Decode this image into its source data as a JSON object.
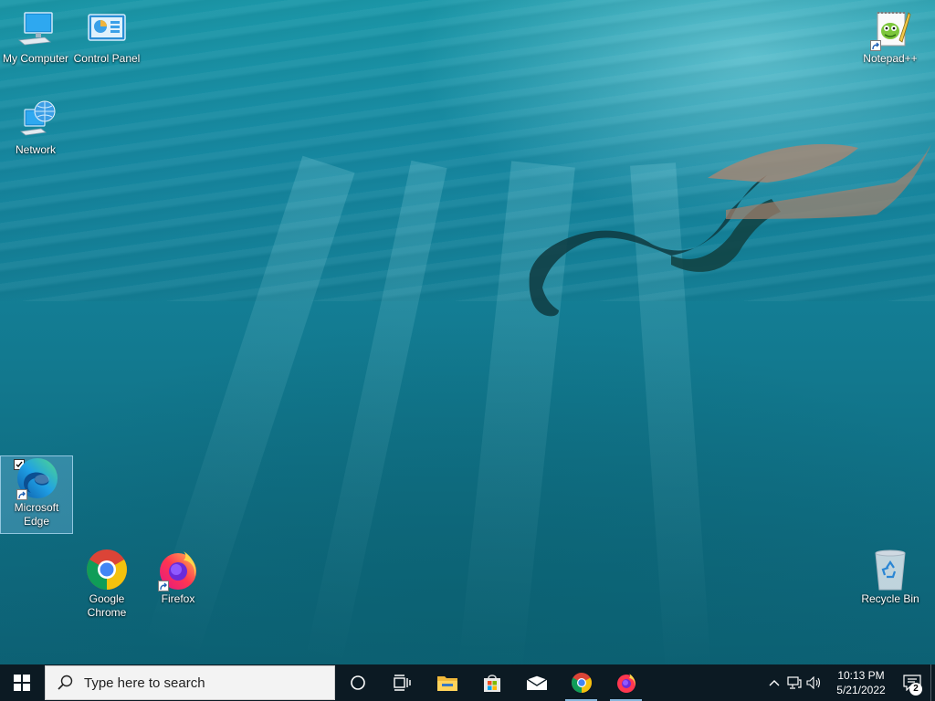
{
  "desktop": {
    "icons": [
      {
        "name": "my-computer-icon",
        "label": "My Computer"
      },
      {
        "name": "control-panel-icon",
        "label": "Control Panel"
      },
      {
        "name": "network-icon",
        "label": "Network"
      },
      {
        "name": "notepad-plus-plus-icon",
        "label": "Notepad++"
      },
      {
        "name": "microsoft-edge-icon",
        "label": "Microsoft Edge"
      },
      {
        "name": "google-chrome-icon",
        "label": "Google Chrome"
      },
      {
        "name": "firefox-icon",
        "label": "Firefox"
      },
      {
        "name": "recycle-bin-icon",
        "label": "Recycle Bin"
      }
    ],
    "selected_icon": "Microsoft Edge"
  },
  "taskbar": {
    "start_icon": "windows-start-icon",
    "search": {
      "placeholder": "Type here to search"
    },
    "buttons": [
      {
        "name": "cortana-button",
        "icon": "circle-icon"
      },
      {
        "name": "task-view-button",
        "icon": "task-view-icon"
      },
      {
        "name": "file-explorer-button",
        "icon": "folder-icon"
      },
      {
        "name": "microsoft-store-button",
        "icon": "store-bag-icon"
      },
      {
        "name": "mail-button",
        "icon": "mail-icon"
      },
      {
        "name": "chrome-taskbar-button",
        "icon": "chrome-icon",
        "running": true
      },
      {
        "name": "firefox-taskbar-button",
        "icon": "firefox-icon",
        "running": true
      }
    ],
    "tray": {
      "icons": [
        "chevron-up-icon",
        "network-status-icon",
        "speaker-icon"
      ],
      "time": "10:13 PM",
      "date": "5/21/2022",
      "notification_count": "2"
    }
  },
  "colors": {
    "taskbar": "#0c1a23",
    "water_top": "#1b97a8",
    "water_bottom": "#0d6175",
    "running_indicator": "#88b8dd"
  }
}
